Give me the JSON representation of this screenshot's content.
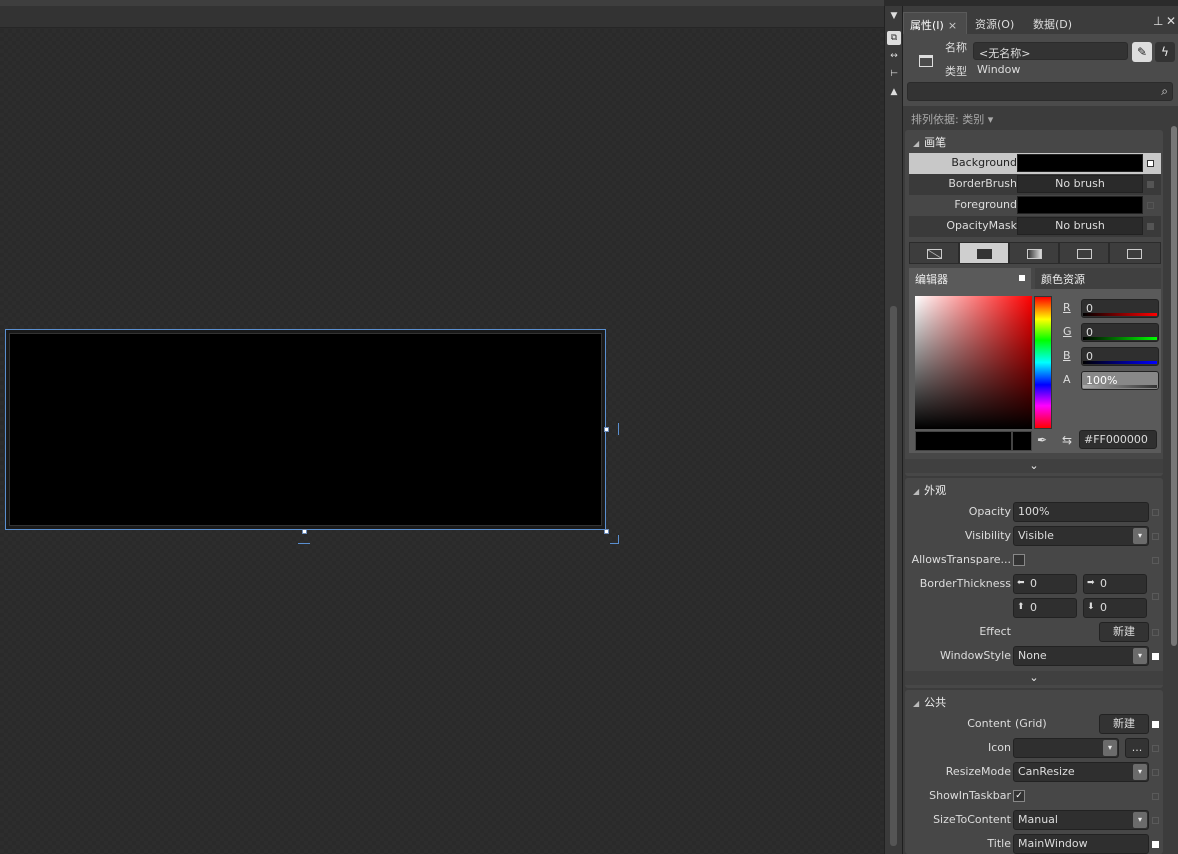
{
  "panel": {
    "tabs": [
      {
        "label": "属性(I)"
      },
      {
        "label": "资源(O)"
      },
      {
        "label": "数据(D)"
      }
    ],
    "close_glyph": "×",
    "pin_glyph": "⊥",
    "panel_close_glyph": "✕",
    "name_label": "名称",
    "name_value": "<无名称>",
    "type_label": "类型",
    "type_value": "Window",
    "sort_label": "排列依据: 类别 ▾",
    "icons": [
      "window-icon",
      "wrench-icon",
      "lightning-icon",
      "search-icon"
    ]
  },
  "brush_section": {
    "title": "画笔",
    "rows": [
      {
        "label": "Background",
        "value": ""
      },
      {
        "label": "BorderBrush",
        "value": "No brush"
      },
      {
        "label": "Foreground",
        "value": ""
      },
      {
        "label": "OpacityMask",
        "value": "No brush"
      }
    ],
    "editor_tabs": {
      "editor": "编辑器",
      "resources": "颜色资源"
    },
    "r_label": "R",
    "r_value": "0",
    "g_label": "G",
    "g_value": "0",
    "b_label": "B",
    "b_value": "0",
    "a_label": "A",
    "a_value": "100%",
    "hex_value": "#FF000000",
    "selected_color": "#000000"
  },
  "appearance_section": {
    "title": "外观",
    "opacity_label": "Opacity",
    "opacity_value": "100%",
    "visibility_label": "Visibility",
    "visibility_value": "Visible",
    "allows_label": "AllowsTranspare...",
    "border_label": "BorderThickness",
    "border_left": "0",
    "border_right": "0",
    "border_top": "0",
    "border_bottom": "0",
    "effect_label": "Effect",
    "new_label": "新建",
    "windowstyle_label": "WindowStyle",
    "windowstyle_value": "None"
  },
  "common_section": {
    "title": "公共",
    "content_label": "Content",
    "content_value": "(Grid)",
    "new_label": "新建",
    "icon_label": "Icon",
    "icon_value": "",
    "browse_label": "...",
    "resize_label": "ResizeMode",
    "resize_value": "CanResize",
    "taskbar_label": "ShowInTaskbar",
    "size_label": "SizeToContent",
    "size_value": "Manual",
    "title_label": "Title",
    "title_value": "MainWindow"
  },
  "glyphs": {
    "caret_down": "▾",
    "chevron": "⌄",
    "check": "✓",
    "section_caret": "◢"
  }
}
